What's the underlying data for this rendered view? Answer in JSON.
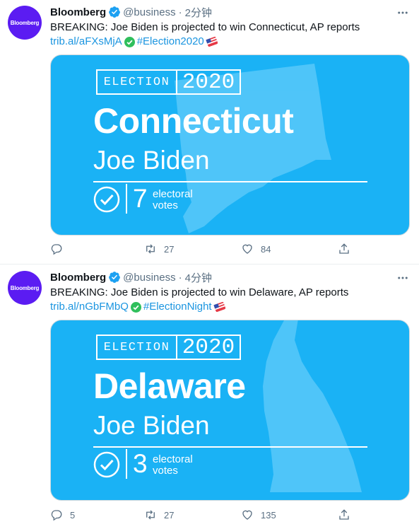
{
  "tweets": [
    {
      "avatar_text": "Bloomberg",
      "name": "Bloomberg",
      "handle": "@business",
      "dot": "·",
      "time": "2分钟",
      "text": "BREAKING: Joe Biden is projected to win Connecticut, AP reports",
      "link": "trib.al/aFXsMjA",
      "hashtag": "#Election2020",
      "card": {
        "label": "ELECTION",
        "year": "2020",
        "state": "Connecticut",
        "candidate": "Joe Biden",
        "votes": "7",
        "votes_label_1": "electoral",
        "votes_label_2": "votes"
      },
      "reply_count": "",
      "retweet_count": "27",
      "like_count": "84"
    },
    {
      "avatar_text": "Bloomberg",
      "name": "Bloomberg",
      "handle": "@business",
      "dot": "·",
      "time": "4分钟",
      "text": "BREAKING: Joe Biden is projected to win Delaware, AP reports",
      "link": "trib.al/nGbFMbQ",
      "hashtag": "#ElectionNight",
      "card": {
        "label": "ELECTION",
        "year": "2020",
        "state": "Delaware",
        "candidate": "Joe Biden",
        "votes": "3",
        "votes_label_1": "electoral",
        "votes_label_2": "votes"
      },
      "reply_count": "5",
      "retweet_count": "27",
      "like_count": "135"
    }
  ],
  "colors": {
    "card_bg": "#1ab2f5",
    "avatar_bg": "#5b1cf2",
    "link": "#1b95e0",
    "verified": "#1da1f2",
    "muted": "#5b7083"
  },
  "icons": [
    "verified-badge-icon",
    "more-icon",
    "check-mark-emoji-icon",
    "flag-emoji-icon",
    "reply-icon",
    "retweet-icon",
    "like-icon",
    "share-icon",
    "check-circle-icon"
  ]
}
